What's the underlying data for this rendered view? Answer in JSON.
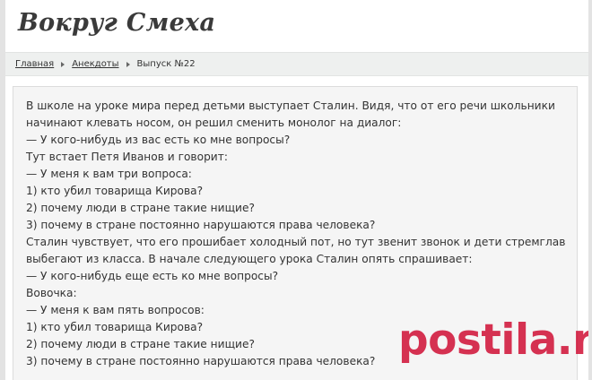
{
  "site": {
    "title": "Вокруг Смеха"
  },
  "breadcrumb": {
    "items": [
      {
        "label": "Главная"
      },
      {
        "label": "Анекдоты"
      }
    ],
    "current": "Выпуск №22"
  },
  "joke": {
    "lines": [
      "В школе на уроке мира перед детьми выступает Сталин. Видя, что от его речи школьники",
      "начинают клевать носом, он решил сменить монолог на диалог:",
      "— У кого-нибудь из вас есть ко мне вопросы?",
      "Тут встает Петя Иванов и говорит:",
      "— У меня к вам три вопроса:",
      "1) кто убил товарища Кирова?",
      "2) почему люди в стране такие нищие?",
      "3) почему в стране постоянно нарушаются права человека?",
      "Сталин чувствует, что его прошибает холодный пот, но тут звенит звонок и дети стремглав",
      "выбегают из класса. В начале следующего урока Сталин опять спрашивает:",
      "— У кого-нибудь еще есть ко мне вопросы?",
      "Вовочка:",
      "— У меня к вам пять вопросов:",
      "1) кто убил товарища Кирова?",
      "2) почему люди в стране такие нищие?",
      "3) почему в стране постоянно нарушаются права человека?"
    ]
  },
  "watermark": {
    "text": "postila.ru",
    "color": "#cd0028"
  }
}
